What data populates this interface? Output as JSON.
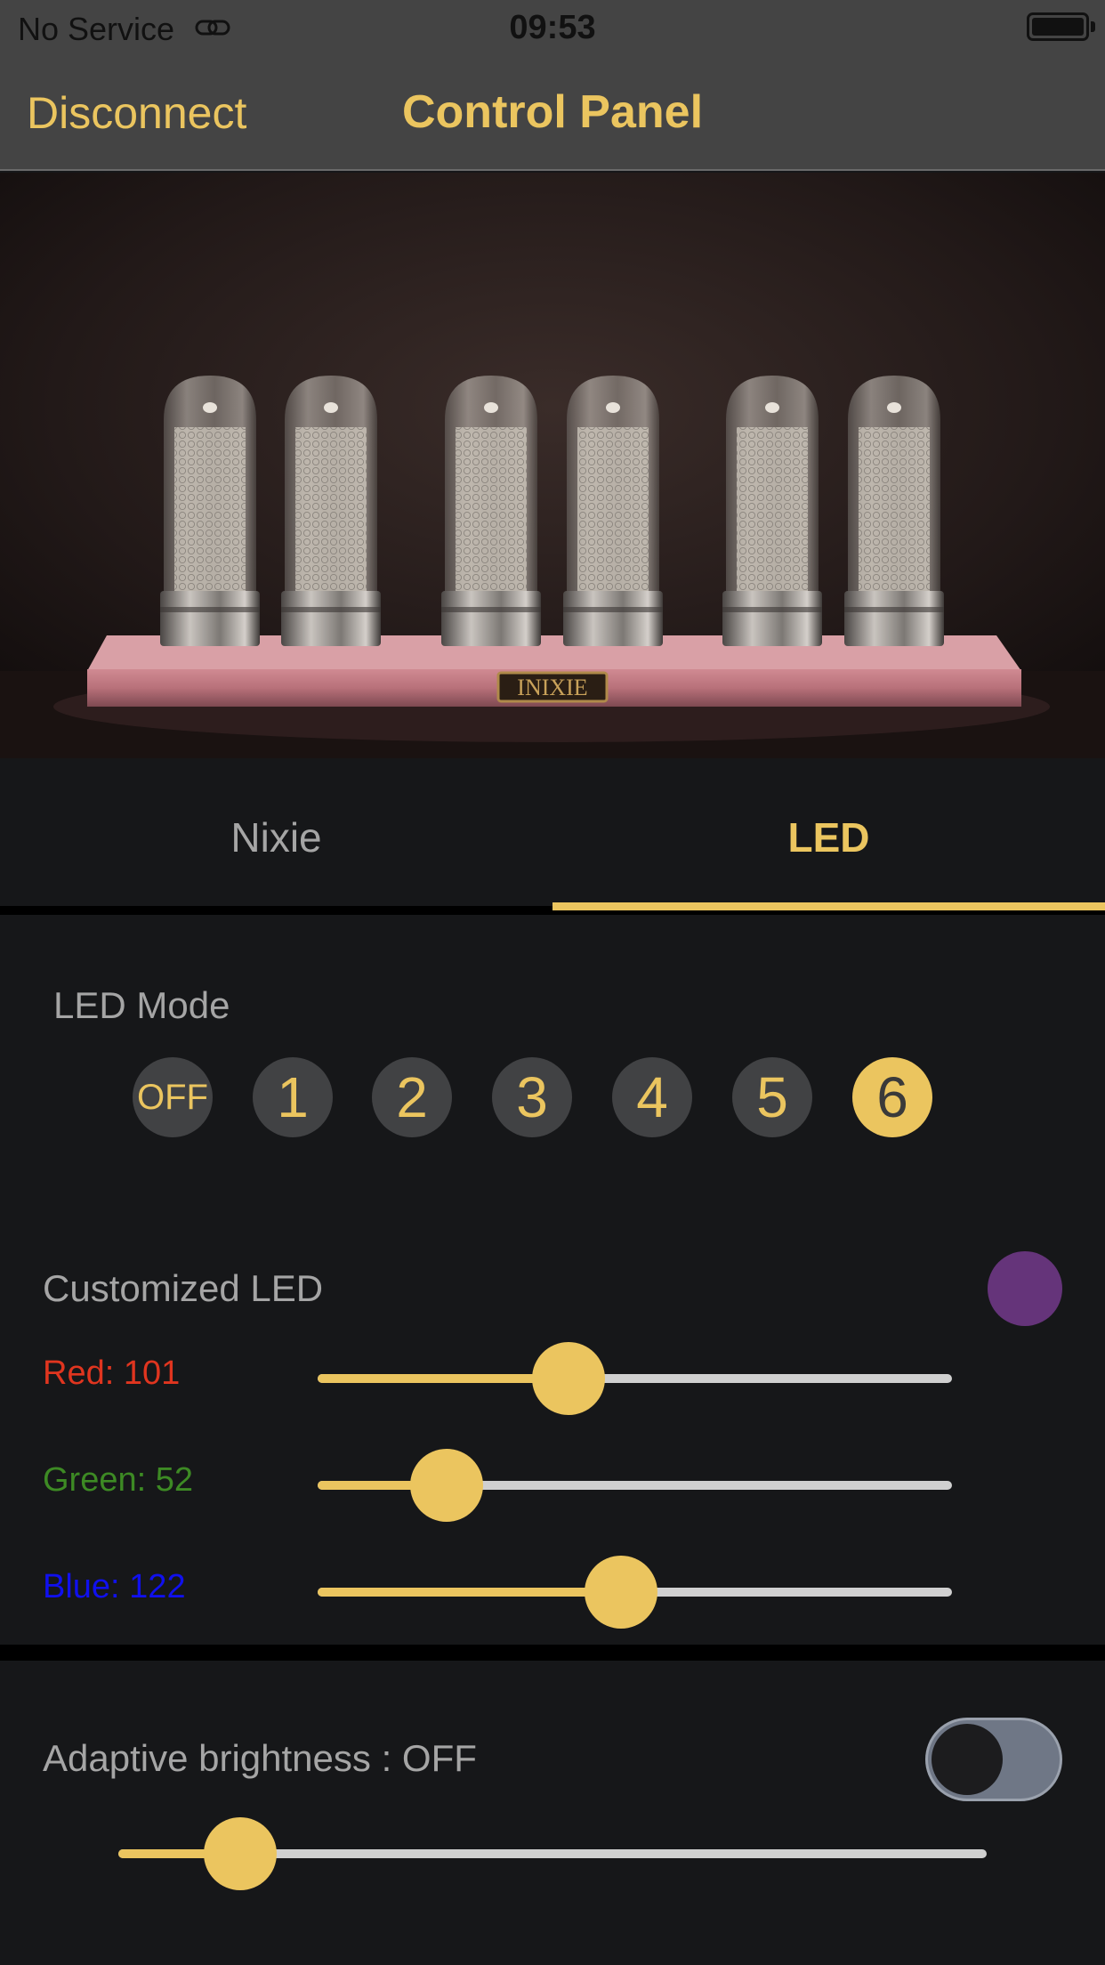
{
  "status_bar": {
    "carrier": "No Service",
    "time": "09:53",
    "link_icon": "link-icon",
    "battery_icon": "battery-icon"
  },
  "nav": {
    "left_button": "Disconnect",
    "title": "Control Panel"
  },
  "hero": {
    "brand_plate": "INIXIE"
  },
  "tabs": [
    {
      "label": "Nixie",
      "selected": false
    },
    {
      "label": "LED",
      "selected": true
    }
  ],
  "led_mode": {
    "title": "LED Mode",
    "options": [
      "OFF",
      "1",
      "2",
      "3",
      "4",
      "5",
      "6"
    ],
    "selected": "6"
  },
  "customized_led": {
    "title": "Customized LED",
    "swatch_color": "#65347a",
    "sliders": [
      {
        "label": "Red: 101",
        "value": 101,
        "max": 255,
        "color": "#e0351f"
      },
      {
        "label": "Green: 52",
        "value": 52,
        "max": 255,
        "color": "#3d8a24"
      },
      {
        "label": "Blue: 122",
        "value": 122,
        "max": 255,
        "color": "#1010ee"
      }
    ]
  },
  "adaptive_brightness": {
    "label": "Adaptive brightness : OFF",
    "toggle_on": false,
    "level": 0.14
  },
  "colors": {
    "accent": "#ebc55f",
    "background": "#161719",
    "nav_background": "#444444"
  }
}
